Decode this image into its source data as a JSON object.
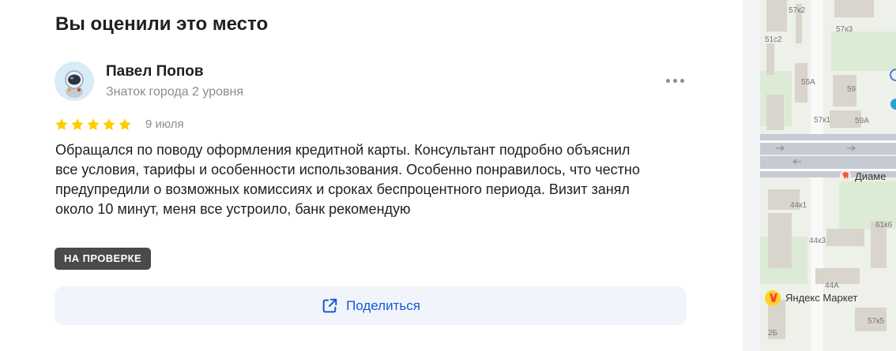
{
  "section": {
    "title": "Вы оценили это место"
  },
  "review": {
    "author_name": "Павел Попов",
    "author_level": "Знаток города 2 уровня",
    "rating": 5,
    "date": "9 июля",
    "text": "Обращался по поводу оформления кредитной карты. Консультант подробно объяснил все условия, тарифы и особенности использования. Особенно понравилось, что честно предупредили о возможных комиссиях и сроках беспроцентного периода. Визит занял около 10 минут, меня все устроило, банк рекомендую",
    "status": "НА ПРОВЕРКЕ",
    "more_icon": "more-horizontal-icon",
    "star_color": "#fc3f1d"
  },
  "share": {
    "label": "Поделиться",
    "icon": "share-icon",
    "color": "#1558d6"
  },
  "map": {
    "labels": {
      "b57k2": "57к2",
      "b51c2": "51с2",
      "b57k3": "57к3",
      "b55a": "55А",
      "b59": "59",
      "b57k1": "57к1",
      "b59a": "59А",
      "poi_diamed": "Диаме",
      "b44k1": "44к1",
      "b61k6": "61к6",
      "b44k3": "44к3",
      "b44a": "44А",
      "poi_market": "Яндекс Маркет",
      "b57k5": "57к5",
      "b2b": "2Б"
    }
  }
}
